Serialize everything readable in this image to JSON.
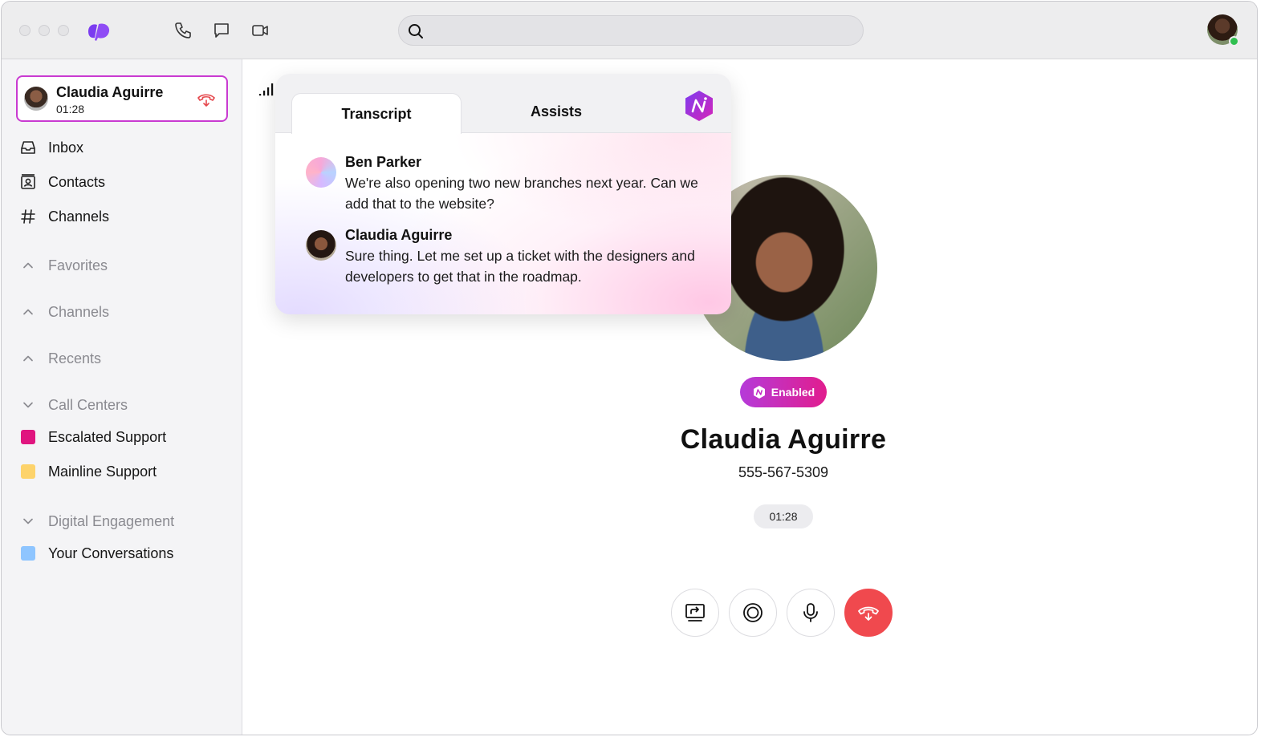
{
  "search": {
    "placeholder": ""
  },
  "active_call": {
    "name": "Claudia Aguirre",
    "duration": "01:28"
  },
  "sidebar": {
    "nav": [
      {
        "label": "Inbox",
        "icon": "inbox-icon"
      },
      {
        "label": "Contacts",
        "icon": "contacts-icon"
      },
      {
        "label": "Channels",
        "icon": "hash-icon"
      }
    ],
    "sections": {
      "favorites": "Favorites",
      "channels": "Channels",
      "recents": "Recents",
      "call_centers": "Call Centers",
      "digital_engagement": "Digital Engagement"
    },
    "call_centers": [
      {
        "label": "Escalated Support",
        "color": "#e0157f"
      },
      {
        "label": "Mainline Support",
        "color": "#fdd36b"
      }
    ],
    "digital": [
      {
        "label": "Your Conversations",
        "color": "#8ec5ff"
      }
    ]
  },
  "panel": {
    "tabs": {
      "transcript": "Transcript",
      "assists": "Assists"
    },
    "messages": [
      {
        "speaker": "Ben Parker",
        "text": "We're also opening two new branches next year. Can we add that to the website?"
      },
      {
        "speaker": "Claudia Aguirre",
        "text": "Sure thing. Let me set up a ticket with the designers and developers to get that in the roadmap."
      }
    ]
  },
  "callee": {
    "ai_status": "Enabled",
    "name": "Claudia Aguirre",
    "phone": "555-567-5309",
    "timer": "01:28"
  },
  "colors": {
    "accent_purple": "#8b3cf0",
    "hangup_red": "#f0494e",
    "active_border": "#c93ad1"
  }
}
